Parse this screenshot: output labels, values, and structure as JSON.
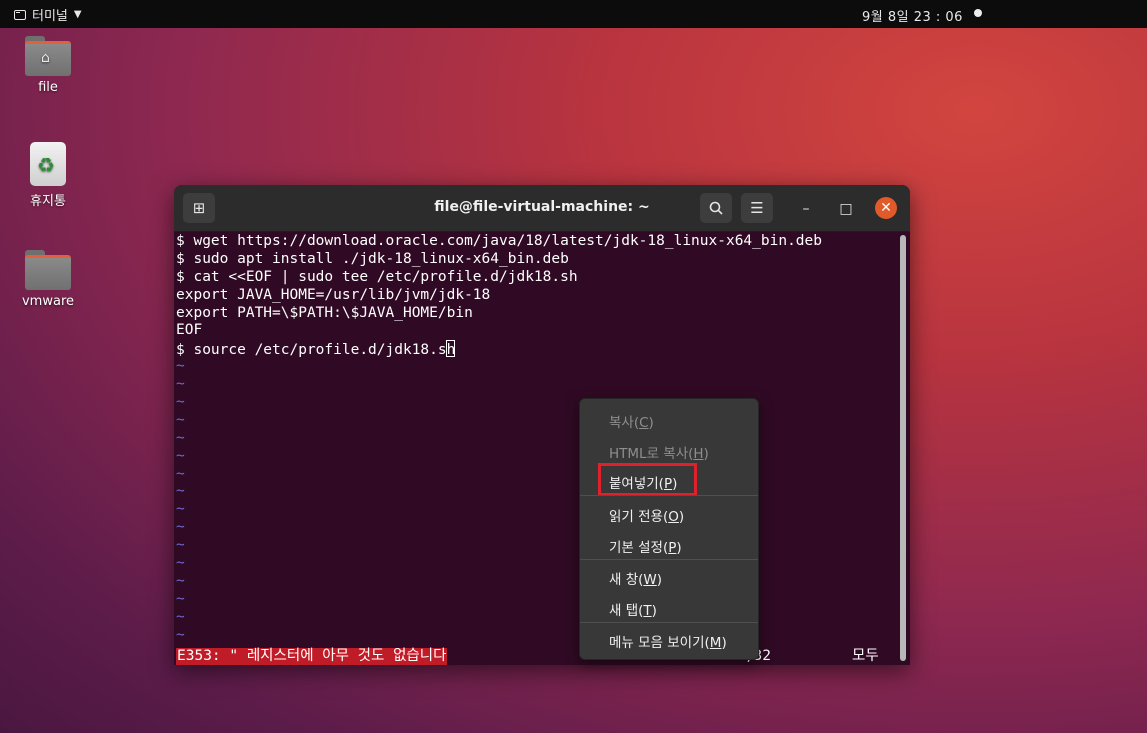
{
  "topbar": {
    "app_name": "터미널",
    "clock": "9월 8일  23 : 06"
  },
  "desktop": {
    "icons": [
      {
        "label": "file",
        "kind": "home-folder-icon"
      },
      {
        "label": "휴지통",
        "kind": "trash-icon"
      },
      {
        "label": "vmware",
        "kind": "folder-icon"
      }
    ]
  },
  "terminal": {
    "title": "file@file-virtual-machine: ~",
    "lines": [
      "$ wget https://download.oracle.com/java/18/latest/jdk-18_linux-x64_bin.deb",
      "$ sudo apt install ./jdk-18_linux-x64_bin.deb",
      "$ cat <<EOF | sudo tee /etc/profile.d/jdk18.sh",
      "export JAVA_HOME=/usr/lib/jvm/jdk-18",
      "export PATH=\\$PATH:\\$JAVA_HOME/bin",
      "EOF",
      "$ source /etc/profile.d/jdk18.sh"
    ],
    "tilde": "~",
    "error_message": "E353: \" 레지스터에 아무 것도 없습니다",
    "cursor_pos": "7,32",
    "scope": "모두"
  },
  "context_menu": {
    "items": [
      {
        "text": "복사(",
        "key": "C",
        "end": ")",
        "enabled": false
      },
      {
        "text": "HTML로 복사(",
        "key": "H",
        "end": ")",
        "enabled": false
      },
      {
        "text": "붙여넣기(",
        "key": "P",
        "end": ")",
        "enabled": true,
        "highlighted": true
      },
      {
        "text": "읽기 전용(",
        "key": "O",
        "end": ")",
        "enabled": true
      },
      {
        "text": "기본 설정(",
        "key": "P",
        "end": ")",
        "enabled": true
      },
      {
        "text": "새 창(",
        "key": "W",
        "end": ")",
        "enabled": true
      },
      {
        "text": "새 탭(",
        "key": "T",
        "end": ")",
        "enabled": true
      },
      {
        "text": "메뉴 모음 보이기(",
        "key": "M",
        "end": ")",
        "enabled": true
      }
    ]
  },
  "colors": {
    "terminal_bg": "#300a24",
    "error_bg": "#c01c28",
    "highlight_box": "#e0202a",
    "close_button": "#e05a2a"
  }
}
